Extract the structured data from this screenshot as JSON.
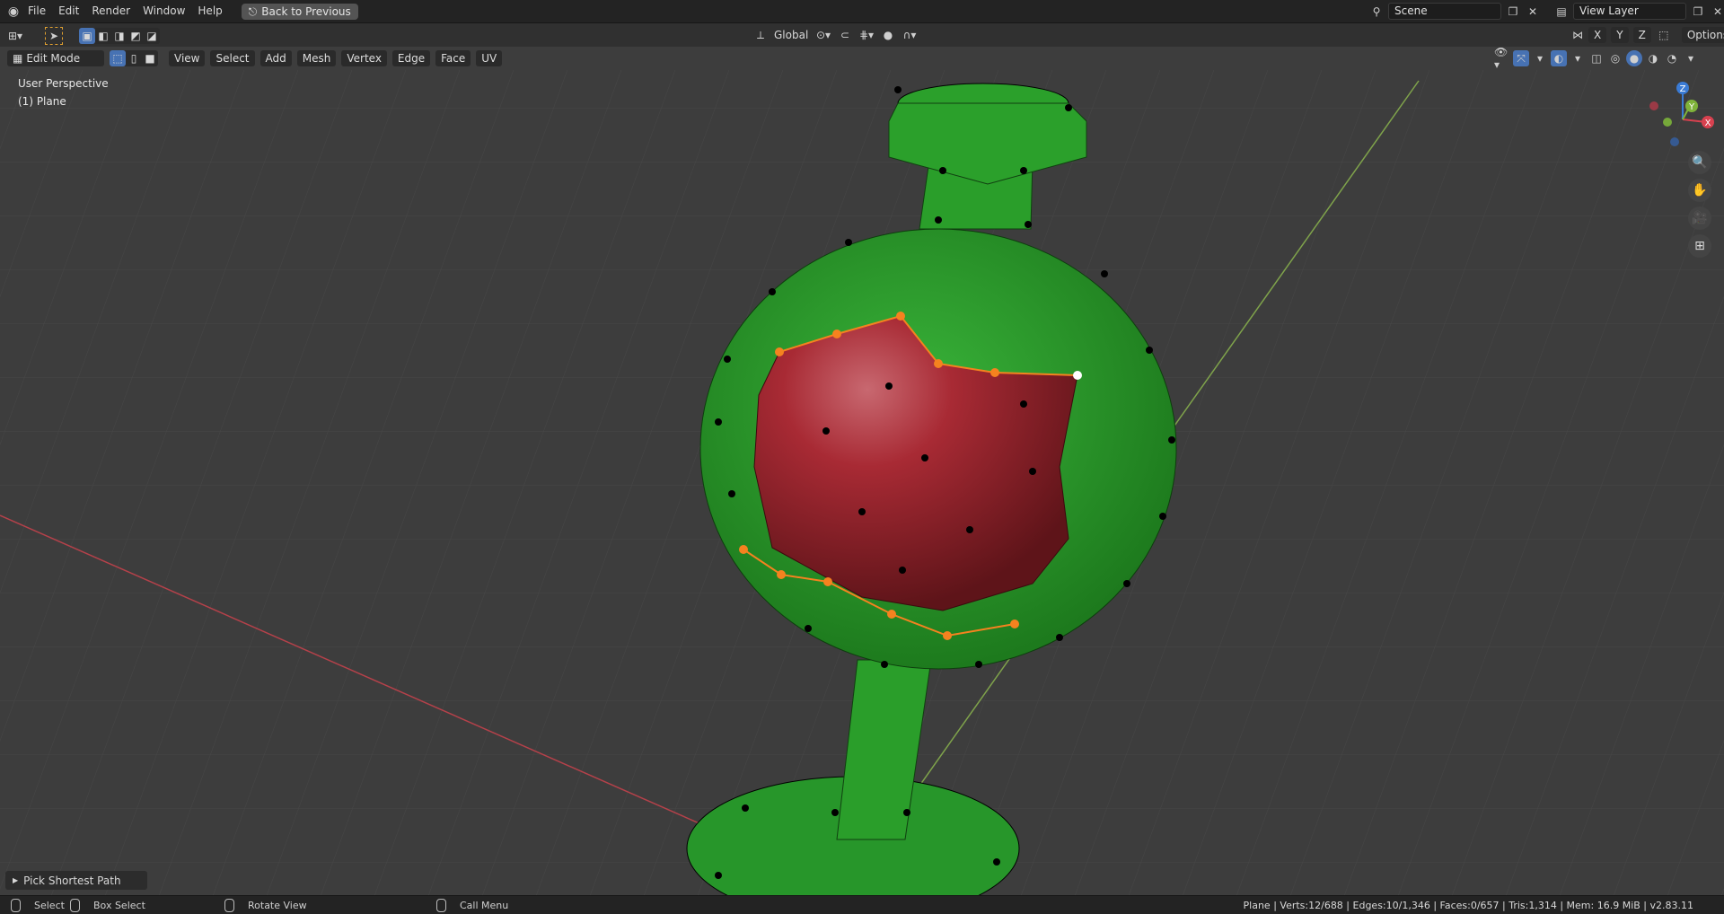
{
  "topbar": {
    "menus": [
      "File",
      "Edit",
      "Render",
      "Window",
      "Help"
    ],
    "back_button": "Back to Previous",
    "scene_label": "Scene",
    "view_layer_label": "View Layer"
  },
  "tool_header": {
    "orientation": "Global",
    "options_label": "Options",
    "axis_x": "X",
    "axis_y": "Y",
    "axis_z": "Z"
  },
  "viewport_header": {
    "mode": "Edit Mode",
    "menus": [
      "View",
      "Select",
      "Add",
      "Mesh",
      "Vertex",
      "Edge",
      "Face",
      "UV"
    ]
  },
  "viewport": {
    "perspective": "User Perspective",
    "object": "(1) Plane",
    "gizmo": {
      "x": "X",
      "y": "Y",
      "z": "Z"
    },
    "colors": {
      "mesh_green": "#2ea32e",
      "selected_red": "#a3232e",
      "vertex_selected": "#f5821f",
      "x_axis": "#b5414a",
      "y_axis": "#7fa34b",
      "grid_bg": "#3d3d3d"
    }
  },
  "operator_panel": {
    "label": "Pick Shortest Path"
  },
  "statusbar": {
    "select": "Select",
    "box_select": "Box Select",
    "rotate_view": "Rotate View",
    "call_menu": "Call Menu",
    "stats": "Plane | Verts:12/688 | Edges:10/1,346 | Faces:0/657 | Tris:1,314 | Mem: 16.9 MiB | v2.83.11"
  }
}
